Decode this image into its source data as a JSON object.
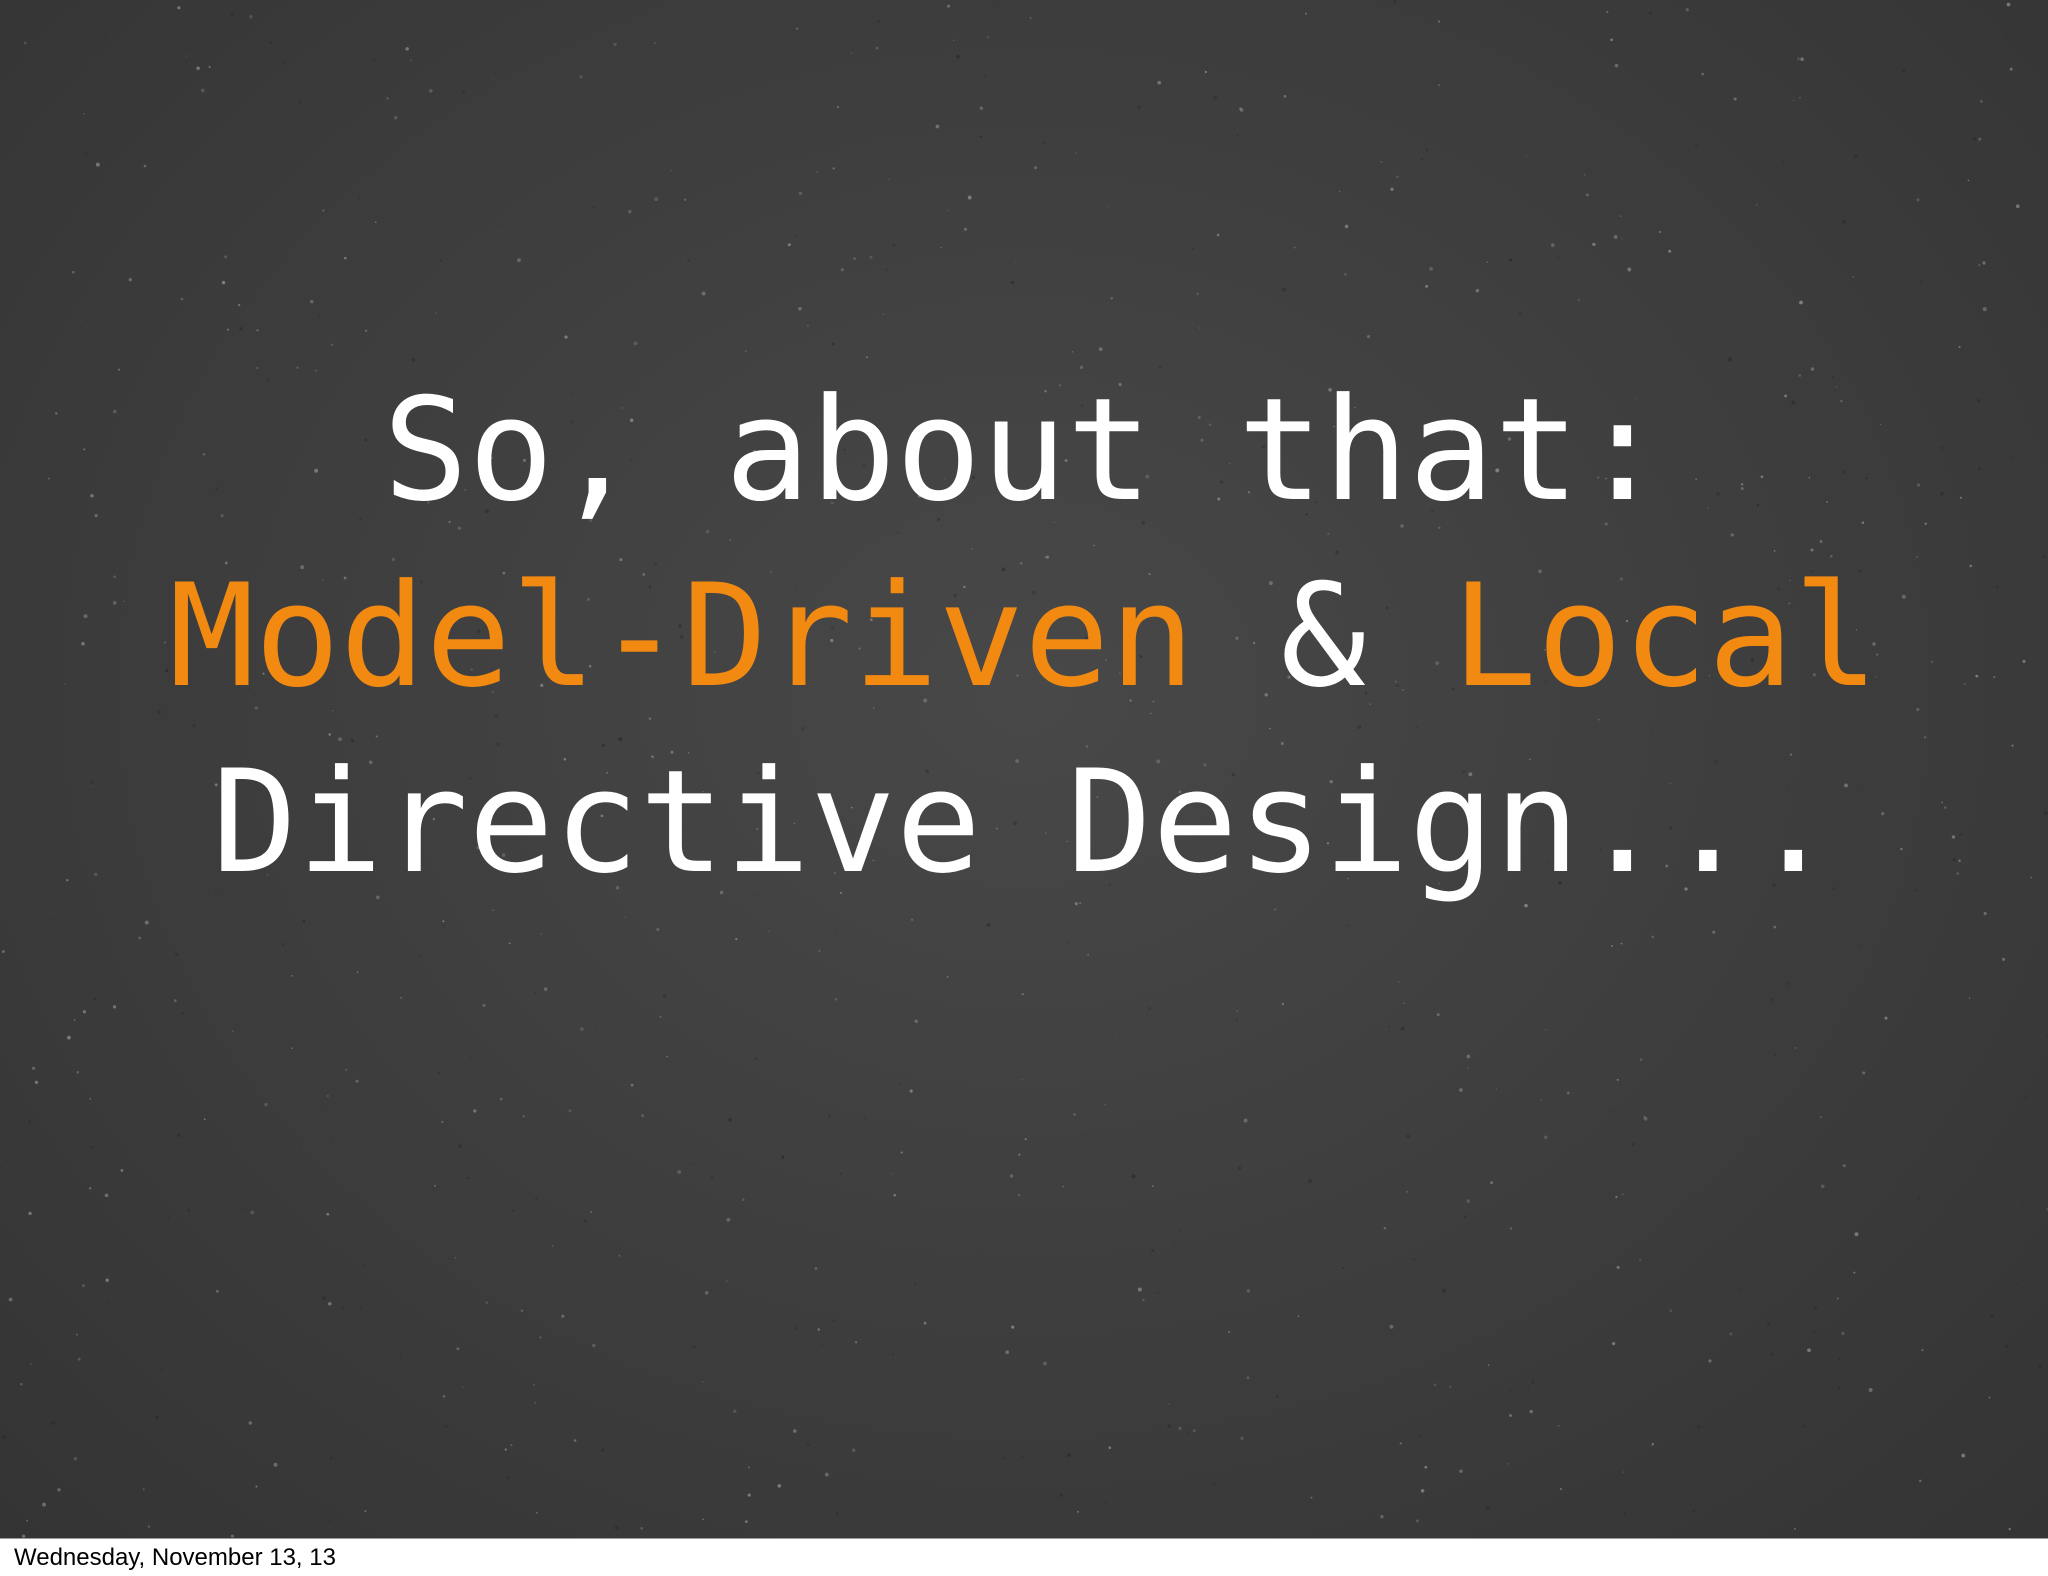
{
  "slide": {
    "line1": "So, about that:",
    "line2": {
      "part1": "Model-Driven",
      "part2": " & ",
      "part3": "Local"
    },
    "line3": "Directive Design..."
  },
  "footer": {
    "date": "Wednesday, November 13, 13"
  },
  "colors": {
    "background": "#3e3e3e",
    "text": "#ffffff",
    "accent": "#f28a12"
  }
}
